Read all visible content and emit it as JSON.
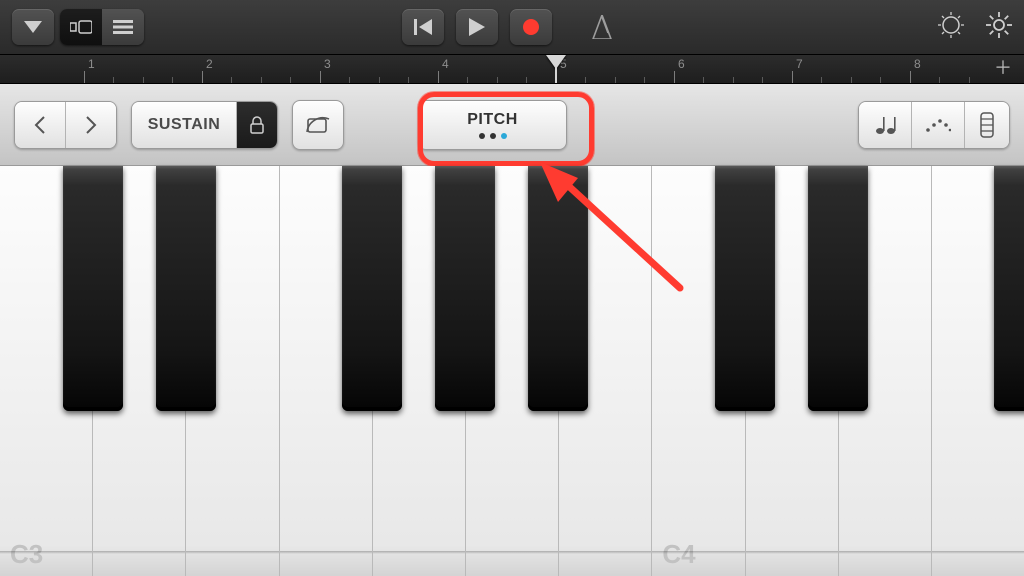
{
  "ruler": {
    "bars": [
      "1",
      "2",
      "3",
      "4",
      "5",
      "6",
      "7",
      "8"
    ],
    "playhead_bar": 5
  },
  "toolbar": {
    "sustain_label": "SUSTAIN",
    "pitch_label": "PITCH"
  },
  "keyboard": {
    "octave_labels": {
      "c3": "C3",
      "c4": "C4"
    }
  },
  "icons": {
    "browser": "browser-triangle-icon",
    "tracks_view": "tracks-view-icon",
    "mixer_view": "mixer-view-icon",
    "rewind": "rewind-icon",
    "play": "play-icon",
    "record": "record-icon",
    "metronome": "metronome-icon",
    "master_volume": "master-volume-dial-icon",
    "settings": "gear-icon",
    "octave_prev": "chevron-left-icon",
    "octave_next": "chevron-right-icon",
    "lock": "lock-icon",
    "glissando": "glissando-icon",
    "note_value": "note-value-icon",
    "arpeggiator": "arpeggiator-icon",
    "keyboard_layout": "keyboard-layout-icon",
    "add_section": "plus-icon"
  }
}
